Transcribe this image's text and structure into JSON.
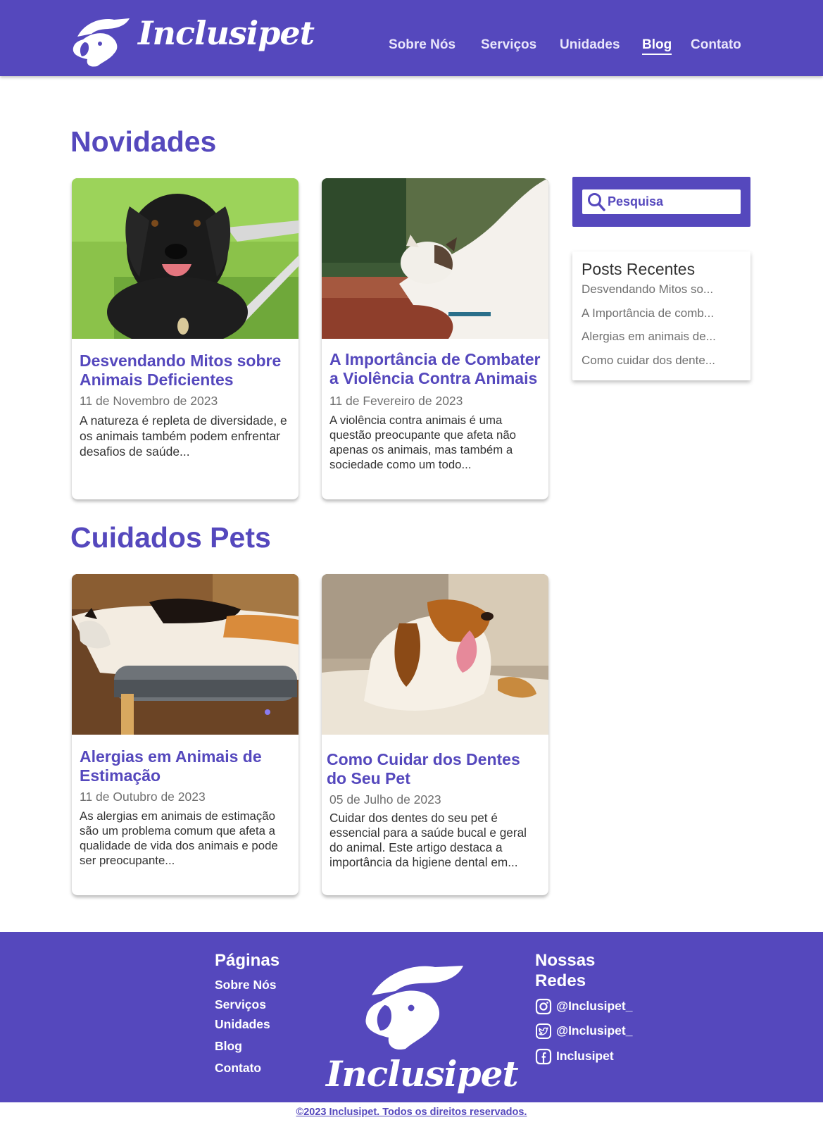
{
  "brand": {
    "name": "Inclusipet",
    "color": "#5548bd"
  },
  "header": {
    "nav": [
      {
        "label": "Sobre Nós",
        "active": false
      },
      {
        "label": "Serviços",
        "active": false
      },
      {
        "label": "Unidades",
        "active": false
      },
      {
        "label": "Blog",
        "active": true
      },
      {
        "label": "Contato",
        "active": false
      }
    ]
  },
  "sections": [
    {
      "title": "Novidades",
      "posts": [
        {
          "image": "black-dog-wheelchair-photo",
          "title": "Desvendando Mitos sobre Animais Deficientes",
          "date": "11 de Novembro de 2023",
          "excerpt": "A natureza é repleta de diversidade, e os animais também podem enfrentar desafios de saúde..."
        },
        {
          "image": "cat-stretching-photo",
          "title": "A Importância de Combater a Violência Contra Animais",
          "date": "11 de Fevereiro de 2023",
          "excerpt": "A violência contra animais é uma questão preocupante que afeta não apenas os animais, mas também a sociedade como um todo..."
        }
      ]
    },
    {
      "title": "Cuidados Pets",
      "posts": [
        {
          "image": "calico-cat-resting-photo",
          "title": "Alergias em Animais de Estimação",
          "date": "11 de Outubro de 2023",
          "excerpt": "As alergias em animais de estimação são um problema comum que afeta a qualidade de vida dos animais e pode ser preocupante..."
        },
        {
          "image": "beagle-yawning-photo",
          "title": "Como Cuidar dos Dentes do Seu Pet",
          "date": "05 de Julho de 2023",
          "excerpt": "Cuidar dos dentes do seu pet é essencial para a saúde bucal e geral do animal. Este artigo destaca a importância da higiene dental em..."
        }
      ]
    }
  ],
  "sidebar": {
    "search": {
      "placeholder": "Pesquisa",
      "icon": "search-icon"
    },
    "recent": {
      "title": "Posts Recentes",
      "items": [
        "Desvendando Mitos so...",
        "A Importância de comb...",
        "Alergias em animais de...",
        "Como cuidar dos dente..."
      ]
    }
  },
  "footer": {
    "pages_title": "Páginas",
    "pages": [
      "Sobre Nós",
      "Serviços",
      "Unidades",
      "Blog",
      "Contato"
    ],
    "social_title": "Nossas Redes",
    "social": [
      {
        "icon": "instagram-icon",
        "label": "@Inclusipet_"
      },
      {
        "icon": "twitter-icon",
        "label": "@Inclusipet_"
      },
      {
        "icon": "facebook-icon",
        "label": "Inclusipet"
      }
    ],
    "copyright": "©2023 Inclusipet. Todos os direitos reservados."
  }
}
